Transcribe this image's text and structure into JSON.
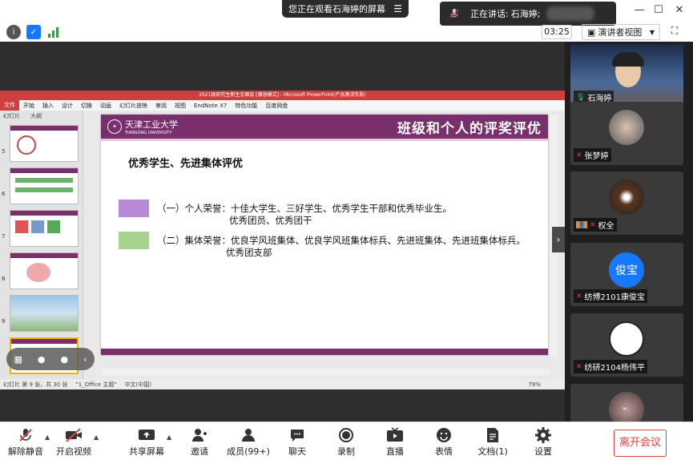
{
  "topbar": {
    "share_notice": "您正在观看石海婷的屏幕",
    "speaking_label": "正在讲话:",
    "speaking_name": "石海婷;",
    "timer": "03:25",
    "view_label": "演讲者视图"
  },
  "ppt": {
    "window_title": "2021级研究生新生见面会 [兼容模式] - Microsoft PowerPoint(产品激活失败)",
    "menu": [
      "文件",
      "开始",
      "插入",
      "设计",
      "切换",
      "动画",
      "幻灯片放映",
      "审阅",
      "视图",
      "EndNote X7",
      "特色功能",
      "百度网盘"
    ],
    "panel_tabs": [
      "幻灯片",
      "大纲"
    ],
    "thumb_numbers": [
      "5",
      "6",
      "7",
      "8",
      "9"
    ],
    "status_slide": "幻灯片 第 9 张，共 30 张",
    "status_theme": "\"1_Office 主题\"",
    "status_lang": "中文(中国)",
    "status_zoom": "79%"
  },
  "slide": {
    "logo_text": "天津工业大学",
    "logo_sub": "TIANGONG UNIVERSITY",
    "title": "班级和个人的评奖评优",
    "heading": "优秀学生、先进集体评优",
    "items": [
      {
        "color": "#b889d9",
        "line1": "（一）个人荣誉：十佳大学生、三好学生、优秀学生干部和优秀毕业生。",
        "line2": "优秀团员、优秀团干"
      },
      {
        "color": "#a6d38e",
        "line1": "（二）集体荣誉：优良学风班集体、优良学风班集体标兵、先进班集体、先进班集体标兵。",
        "line2": "优秀团支部"
      }
    ]
  },
  "participants": [
    {
      "name": "石海婷",
      "icon": "person-video"
    },
    {
      "name": "张梦婷",
      "icon": "photo"
    },
    {
      "name": "权全",
      "icon": "coffee-photo"
    },
    {
      "name": "纺博2101康俊宝",
      "avatar_text": "俊宝",
      "avatar_color": "#1677ff"
    },
    {
      "name": "纺研2104杨伟平",
      "icon": "cartoon-avatar"
    },
    {
      "name": "",
      "icon": "photo"
    }
  ],
  "toolbar": {
    "mute": "解除静音",
    "video": "开启视频",
    "share": "共享屏幕",
    "invite": "邀请",
    "members": "成员(99+)",
    "chat": "聊天",
    "record": "录制",
    "live": "直播",
    "reactions": "表情",
    "docs": "文档(1)",
    "settings": "设置",
    "leave": "离开会议"
  },
  "colors": {
    "accent_red": "#e04040",
    "slide_purple": "#7a2f6d"
  }
}
